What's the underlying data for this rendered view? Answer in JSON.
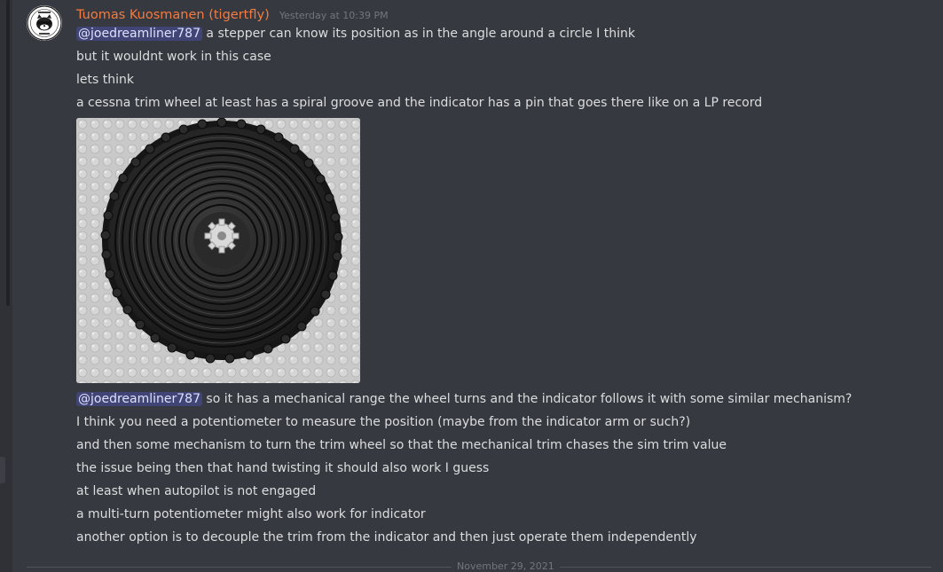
{
  "message": {
    "author": "Tuomas Kuosmanen (tigertfly)",
    "timestamp": "Yesterday at 10:39 PM",
    "avatar_icon": "tigertfly-cat-avatar",
    "author_color": "#f47b41",
    "lines_before_image": [
      {
        "mention": "@joedreamliner787",
        "text": " a stepper can know its position as in the angle around a circle I think"
      },
      {
        "mention": "",
        "text": "but it wouldnt work in this case"
      },
      {
        "mention": "",
        "text": "lets think"
      },
      {
        "mention": "",
        "text": "a cessna trim wheel at least has a spiral groove and the indicator has a pin that goes there like on a LP record"
      }
    ],
    "attachment_icon": "trim-wheel-photo",
    "lines_after_image": [
      {
        "mention": "@joedreamliner787",
        "text": " so it has a mechanical range the wheel turns and the indicator follows it with some similar mechanism?"
      },
      {
        "mention": "",
        "text": "I think you need a potentiometer to measure the position (maybe from the indicator arm or such?)"
      },
      {
        "mention": "",
        "text": "and then some mechanism to turn the trim wheel so that the mechanical trim chases the sim trim value"
      },
      {
        "mention": "",
        "text": "the issue being then that hand twisting it should also work I guess"
      },
      {
        "mention": "",
        "text": "at least when autopilot is not engaged"
      },
      {
        "mention": "",
        "text": "a multi-turn potentiometer might  also work for indicator"
      },
      {
        "mention": "",
        "text": "another option is to decouple the trim from the indicator and then just operate them independently"
      }
    ]
  },
  "date_divider": "November 29, 2021"
}
